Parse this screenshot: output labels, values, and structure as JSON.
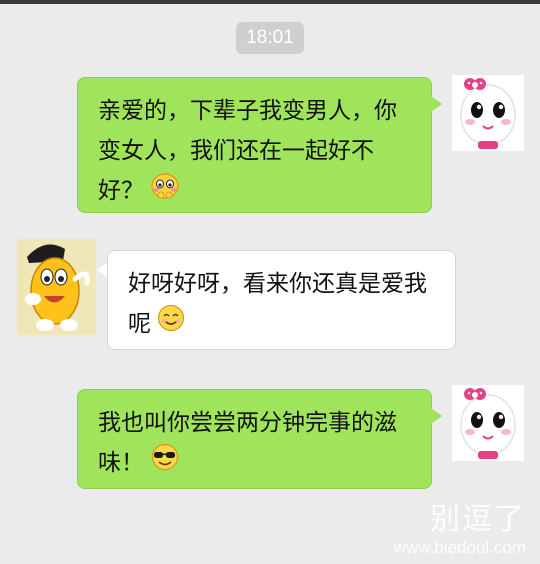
{
  "chat": {
    "timestamp": "18:01",
    "messages": [
      {
        "side": "right",
        "avatar": "cartoon-girl-avatar",
        "text": "亲爱的，下辈子我变男人，你变女人，我们还在一起好不好？",
        "emoji": "shy-blush-emoji"
      },
      {
        "side": "left",
        "avatar": "cartoon-bean-avatar",
        "text": "好呀好呀，看来你还真是爱我呢",
        "emoji": "smile-emoji"
      },
      {
        "side": "right",
        "avatar": "cartoon-girl-avatar",
        "text": "我也叫你尝尝两分钟完事的滋味！",
        "emoji": "cool-sunglasses-emoji"
      }
    ]
  },
  "watermark": {
    "brand": "别逗了",
    "url": "www.biedoul.com"
  },
  "colors": {
    "sent_bubble": "#9fe45a",
    "received_bubble": "#ffffff",
    "background": "#ebebeb"
  }
}
